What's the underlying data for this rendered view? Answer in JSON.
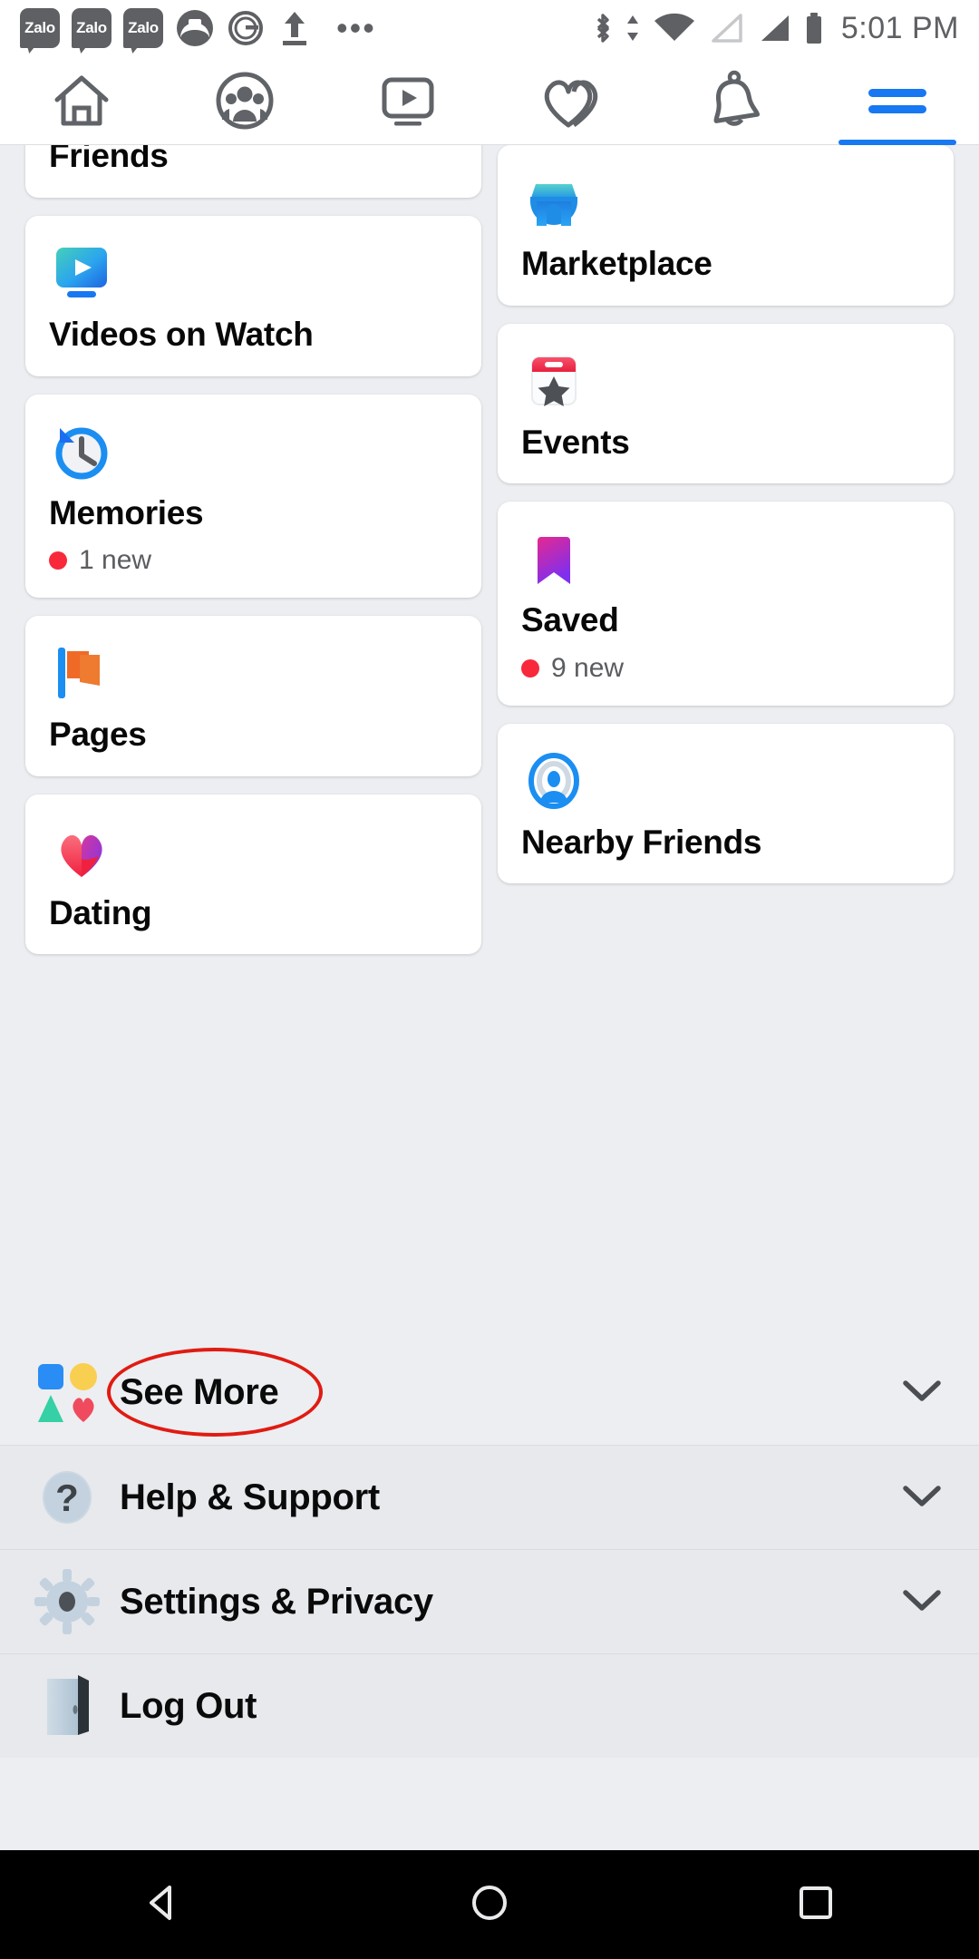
{
  "status_bar": {
    "app_badges": [
      "Zalo",
      "Zalo",
      "Zalo"
    ],
    "icons": [
      "zalo-badge",
      "zalo-badge",
      "zalo-badge",
      "contact-badge",
      "grammarly-badge",
      "upload-icon",
      "more-dots-icon",
      "bluetooth-icon",
      "data-transfer-icon",
      "wifi-icon",
      "signal-empty-icon",
      "signal-full-icon",
      "battery-icon"
    ],
    "overflow": "•••",
    "time": "5:01 PM"
  },
  "top_nav": {
    "tabs": [
      {
        "name": "home",
        "icon": "home-icon",
        "active": false
      },
      {
        "name": "friends",
        "icon": "friends-icon",
        "active": false
      },
      {
        "name": "watch",
        "icon": "watch-video-icon",
        "active": false
      },
      {
        "name": "dating",
        "icon": "heart-dating-icon",
        "active": false
      },
      {
        "name": "notifications",
        "icon": "bell-icon",
        "active": false
      },
      {
        "name": "menu",
        "icon": "hamburger-menu-icon",
        "active": true
      }
    ],
    "active_color": "#1778f2",
    "inactive_color": "#606367"
  },
  "shortcuts": {
    "left_column": [
      {
        "label": "Friends",
        "icon": "friends-people-icon",
        "badge": null
      },
      {
        "label": "Videos on Watch",
        "icon": "watch-play-icon",
        "badge": null
      },
      {
        "label": "Memories",
        "icon": "memories-clock-icon",
        "badge": "1 new"
      },
      {
        "label": "Pages",
        "icon": "pages-flag-icon",
        "badge": null
      },
      {
        "label": "Dating",
        "icon": "dating-heart-icon",
        "badge": null
      }
    ],
    "right_column": [
      {
        "label": "Marketplace",
        "icon": "marketplace-store-icon",
        "badge": null
      },
      {
        "label": "Events",
        "icon": "events-calendar-icon",
        "badge": null
      },
      {
        "label": "Saved",
        "icon": "saved-bookmark-icon",
        "badge": "9 new"
      },
      {
        "label": "Nearby Friends",
        "icon": "nearby-friends-icon",
        "badge": null
      }
    ]
  },
  "menu_rows": [
    {
      "label": "See More",
      "icon": "shapes-icon",
      "chevron": true,
      "shaded": false,
      "annotated": true
    },
    {
      "label": "Help & Support",
      "icon": "help-question-icon",
      "chevron": true,
      "shaded": true,
      "annotated": false
    },
    {
      "label": "Settings & Privacy",
      "icon": "settings-gear-icon",
      "chevron": true,
      "shaded": true,
      "annotated": false
    },
    {
      "label": "Log Out",
      "icon": "logout-door-icon",
      "chevron": false,
      "shaded": true,
      "annotated": false
    }
  ],
  "android_nav": {
    "buttons": [
      "back-triangle-icon",
      "home-circle-icon",
      "recents-square-icon"
    ]
  },
  "colors": {
    "accent_blue": "#1778f2",
    "badge_red": "#f8293a",
    "annotation_red": "#e01b12",
    "page_bg": "#eceef1",
    "card_bg": "#ffffff",
    "text_primary": "#080809",
    "text_secondary": "#5a5c60"
  }
}
